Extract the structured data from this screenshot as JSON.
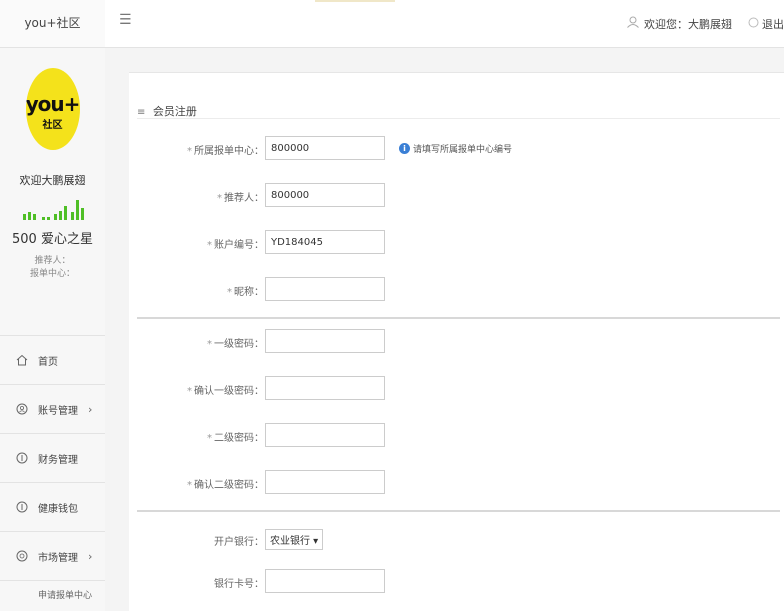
{
  "brand": "you+社区",
  "logo": {
    "main": "you+",
    "sub": "社区"
  },
  "profile": {
    "welcome": "欢迎大鹏展翅",
    "level": "500 爱心之星",
    "referrer_label": "推荐人：",
    "center_label": "报单中心："
  },
  "nav": {
    "items": [
      {
        "label": "首页",
        "icon": "home-icon"
      },
      {
        "label": "账号管理",
        "icon": "account-icon",
        "arrow": "›"
      },
      {
        "label": "财务管理",
        "icon": "finance-icon"
      },
      {
        "label": "健康钱包",
        "icon": "wallet-icon"
      },
      {
        "label": "市场管理",
        "icon": "market-icon",
        "arrow": "›"
      }
    ],
    "sub_items": [
      {
        "label": "申请报单中心"
      }
    ]
  },
  "topbar": {
    "menu_icon": "☰",
    "welcome": "欢迎您：大鹏展翅",
    "logout": "退出"
  },
  "panel": {
    "title": "会员注册",
    "hint": "请填写所属报单中心编号",
    "fields": [
      {
        "label": "所属报单中心：",
        "value": "800000",
        "required": "*"
      },
      {
        "label": "推荐人：",
        "value": "800000",
        "required": "*"
      },
      {
        "label": "账户编号：",
        "value": "YD184045",
        "required": "*"
      },
      {
        "label": "昵称：",
        "value": "",
        "required": "*"
      },
      {
        "label": "一级密码：",
        "value": "",
        "required": "*"
      },
      {
        "label": "确认一级密码：",
        "value": "",
        "required": "*"
      },
      {
        "label": "二级密码：",
        "value": "",
        "required": "*"
      },
      {
        "label": "确认二级密码：",
        "value": "",
        "required": "*"
      }
    ],
    "bank_label": "开户银行：",
    "bank_selected": "农业银行 ▾",
    "card_label": "银行卡号：",
    "card_value": ""
  },
  "colors": {
    "logo_bg": "#f4e21b",
    "signal_green": "#4fbf26",
    "info_blue": "#3a7fd5"
  }
}
